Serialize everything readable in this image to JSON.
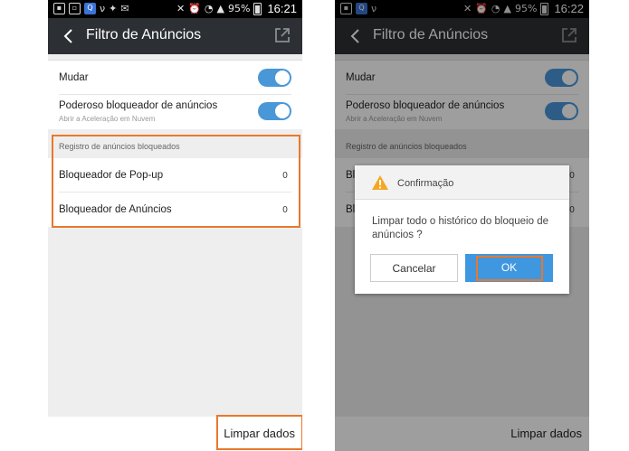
{
  "status_bar": {
    "battery": "95%",
    "time_left": "16:21",
    "time_right": "16:22"
  },
  "app_bar": {
    "title": "Filtro de Anúncios"
  },
  "settings": {
    "mudar_label": "Mudar",
    "blocker_label": "Poderoso bloqueador de anúncios",
    "blocker_sub": "Abrir a Aceleração em Nuvem",
    "mudar_on": true,
    "blocker_on": true
  },
  "blocked_log": {
    "header": "Registro de anúncios bloqueados",
    "popup_label": "Bloqueador de Pop-up",
    "popup_count": "0",
    "ads_label": "Bloqueador de Anúncios",
    "ads_count": "0",
    "popup_label_clipped": "Bl",
    "ads_label_clipped": "Bl"
  },
  "bottom": {
    "clear_label": "Limpar dados"
  },
  "dialog": {
    "title": "Confirmação",
    "message": "Limpar todo o histórico do bloqueio de anúncios ?",
    "cancel_label": "Cancelar",
    "ok_label": "OK"
  },
  "colors": {
    "highlight": "#e8782c",
    "accent": "#4a97d8",
    "appbar": "#2c2f33"
  }
}
